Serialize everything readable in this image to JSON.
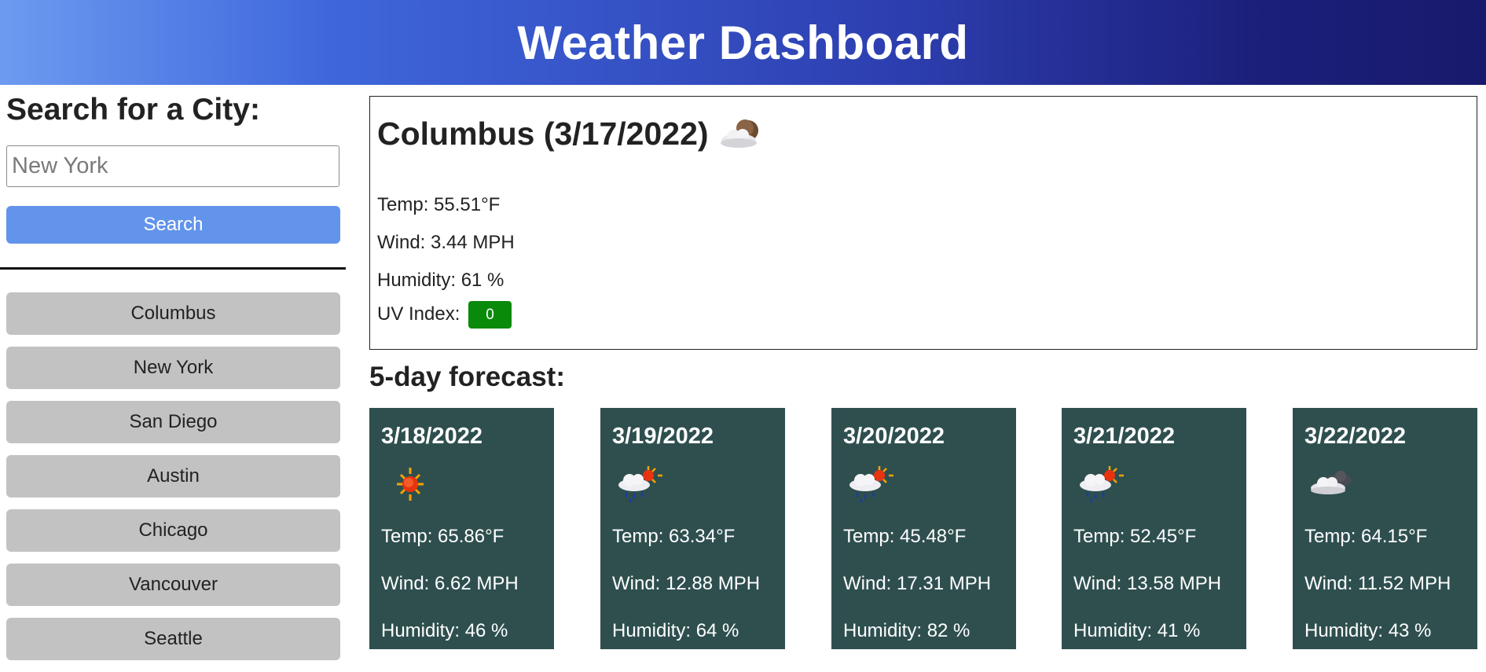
{
  "header": {
    "title": "Weather Dashboard"
  },
  "sidebar": {
    "heading": "Search for a City:",
    "search_placeholder": "New York",
    "search_value": "",
    "search_button": "Search",
    "history": [
      "Columbus",
      "New York",
      "San Diego",
      "Austin",
      "Chicago",
      "Vancouver",
      "Seattle"
    ]
  },
  "current": {
    "title": "Columbus (3/17/2022)",
    "icon": "night-partly-cloudy-icon",
    "temp": "Temp: 55.51°F",
    "wind": "Wind: 3.44 MPH",
    "humidity": "Humidity: 61 %",
    "uv_label": "UV Index:",
    "uv_value": "0",
    "uv_color": "#0a8a0a"
  },
  "forecast": {
    "heading": "5-day forecast:",
    "card_color": "#2f4f4f",
    "days": [
      {
        "date": "3/18/2022",
        "icon": "sun-icon",
        "temp": "Temp: 65.86°F",
        "wind": "Wind: 6.62 MPH",
        "humidity": "Humidity: 46 %"
      },
      {
        "date": "3/19/2022",
        "icon": "sun-rain-cloud-icon",
        "temp": "Temp: 63.34°F",
        "wind": "Wind: 12.88 MPH",
        "humidity": "Humidity: 64 %"
      },
      {
        "date": "3/20/2022",
        "icon": "sun-rain-cloud-icon",
        "temp": "Temp: 45.48°F",
        "wind": "Wind: 17.31 MPH",
        "humidity": "Humidity: 82 %"
      },
      {
        "date": "3/21/2022",
        "icon": "sun-rain-cloud-icon",
        "temp": "Temp: 52.45°F",
        "wind": "Wind: 13.58 MPH",
        "humidity": "Humidity: 41 %"
      },
      {
        "date": "3/22/2022",
        "icon": "dark-cloud-icon",
        "temp": "Temp: 64.15°F",
        "wind": "Wind: 11.52 MPH",
        "humidity": "Humidity: 43 %"
      }
    ]
  }
}
